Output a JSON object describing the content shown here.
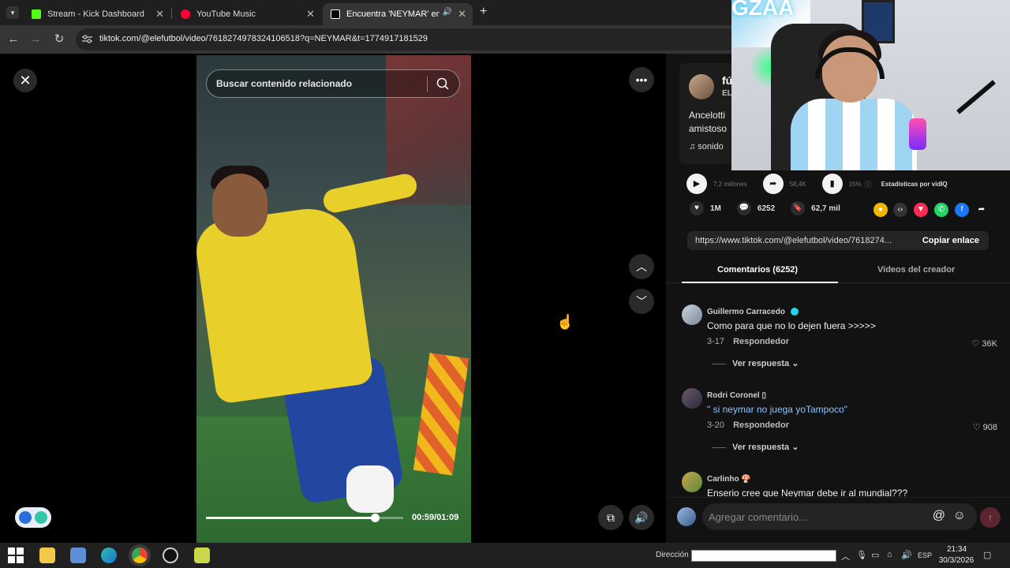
{
  "browser": {
    "tabs": [
      {
        "title": "Stream - Kick Dashboard",
        "icon": "kick-icon",
        "color": "#53fc18"
      },
      {
        "title": "YouTube Music",
        "icon": "youtube-music-icon",
        "color": "#ff0033"
      },
      {
        "title": "Encuentra 'NEYMAR' en Tik",
        "icon": "tiktok-icon",
        "color": "#ffffff",
        "active": true
      }
    ],
    "new_tab": "+",
    "url": "tiktok.com/@elefutbol/video/7618274978324106518?q=NEYMAR&t=1774917181529"
  },
  "video": {
    "search_placeholder": "Buscar contenido relacionado",
    "time": "00:59/01:09",
    "progress": 0.856
  },
  "panel": {
    "creator_name": "fú",
    "creator_sub": "EL",
    "description": "Ancelotti amistoso",
    "music": "♫ sonido",
    "stats": {
      "views": "7,2 millones",
      "shares": "58,4K",
      "percent": "15%",
      "vidiq_label": "Estadísticas por vidIQ"
    },
    "actions": {
      "likes": "1M",
      "comments": "6252",
      "saves": "62,7 mil"
    },
    "link": "https://www.tiktok.com/@elefutbol/video/7618274...",
    "copy_label": "Copiar enlace",
    "tabs": {
      "comments": "Comentarios (6252)",
      "creator_videos": "Videos del creador"
    },
    "comments": [
      {
        "user": "Guillermo Carracedo",
        "text": "Como para que no lo dejen fuera >>>>>",
        "date": "3-17",
        "reply": "Respondedor",
        "likes": "36K",
        "more": "Ver respuesta",
        "verified": true
      },
      {
        "user": "Rodri Coronel ▯",
        "text": "\" si neymar no juega yoTampoco\"",
        "date": "3-20",
        "reply": "Respondedor",
        "likes": "908",
        "more": "Ver respuesta"
      },
      {
        "user": "Carlinho 🍄",
        "text": "Enserio cree que Neymar debe ir al mundial???"
      }
    ],
    "composer_placeholder": "Agregar comentario..."
  },
  "webcam": {
    "wall_text": "GZAA"
  },
  "taskbar": {
    "address_label": "Dirección",
    "language": "ESP",
    "time": "21:34",
    "date": "30/3/2026"
  }
}
